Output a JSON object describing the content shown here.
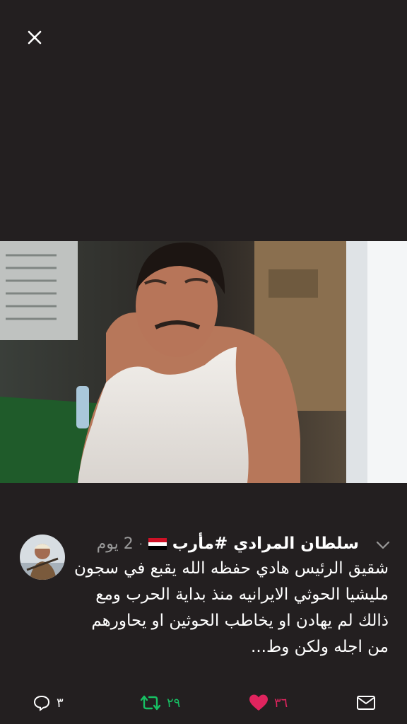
{
  "viewer": {
    "close_icon": "close-icon"
  },
  "tweet": {
    "display_name": "سلطان المرادي #مأرب",
    "time": "2 يوم",
    "separator": "·",
    "text": "شقيق الرئيس هادي حفظه الله يقبع في سجون مليشيا الحوثي الايرانيه منذ بداية الحرب ومع ذالك لم يهادن او يخاطب الحوثين او يحاورهم من اجله ولكن وط...",
    "flag_icon": "yemen-flag-icon"
  },
  "actions": {
    "reply_count": "٣",
    "retweet_count": "٢٩",
    "like_count": "٣٦",
    "colors": {
      "reply": "#ffffff",
      "retweet": "#17bf63",
      "like": "#e0245e",
      "dm": "#ffffff"
    }
  },
  "colors": {
    "background": "#231f20",
    "muted": "#9a9a9a"
  }
}
